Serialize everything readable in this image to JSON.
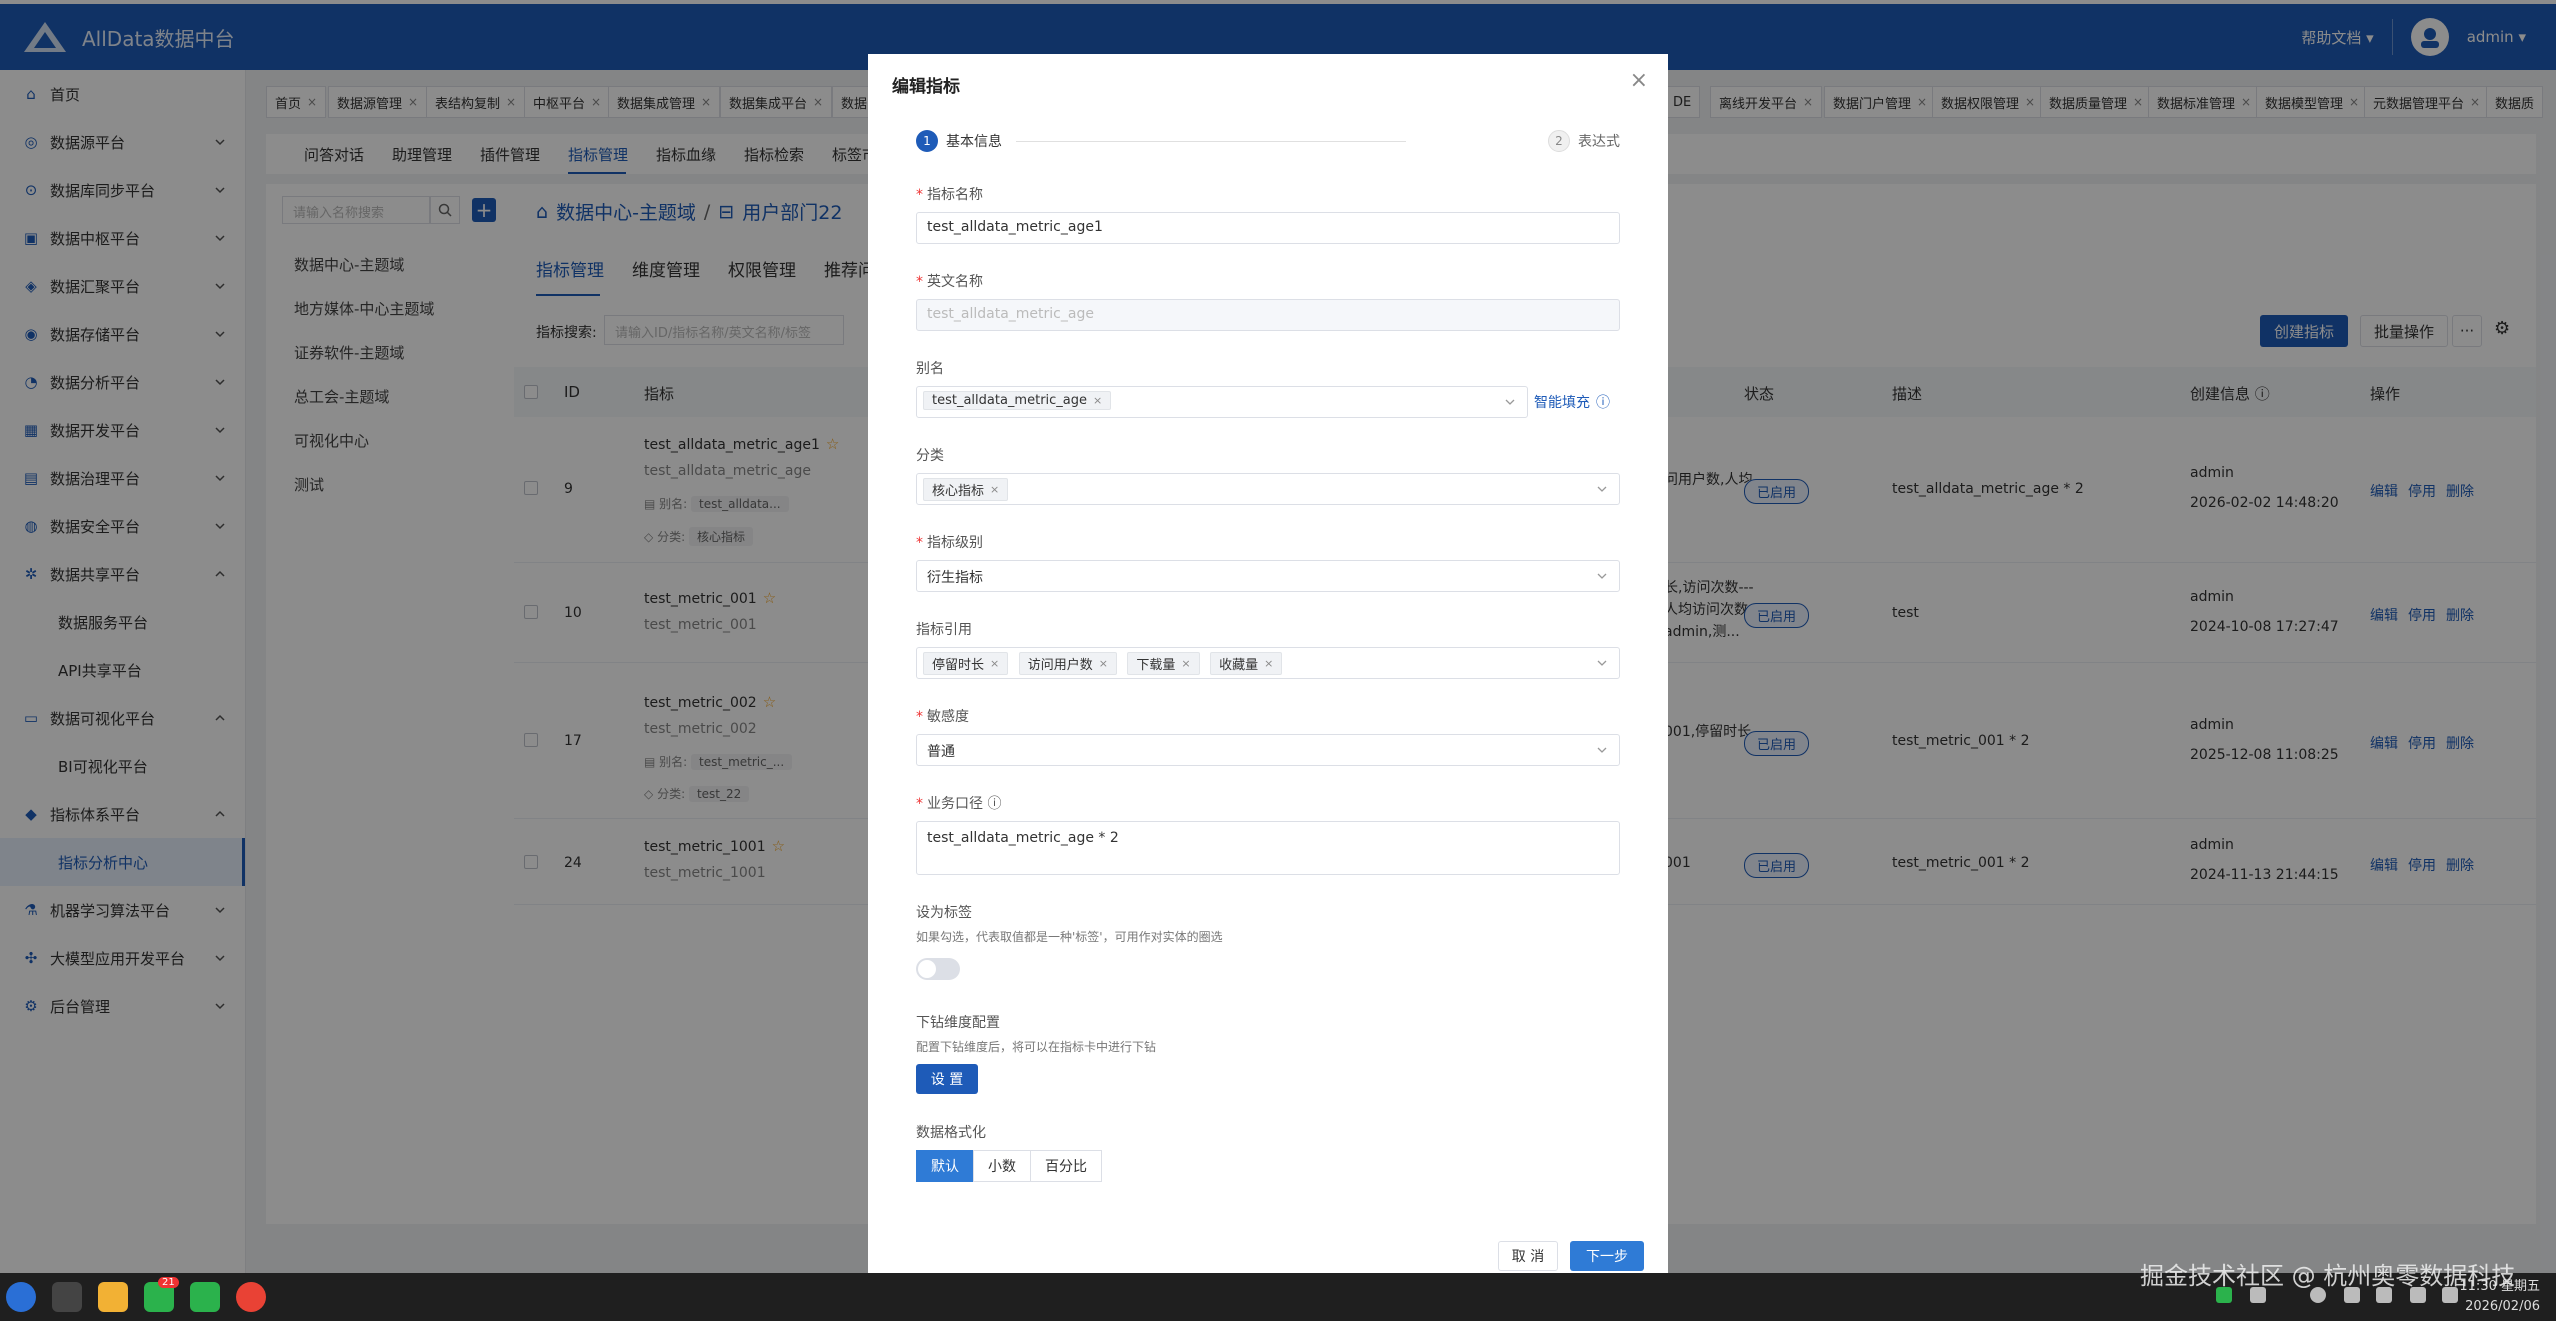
{
  "app": {
    "title": "AllData数据中台",
    "help": "帮助文档",
    "user": "admin"
  },
  "sidebar": {
    "items": [
      {
        "label": "首页"
      },
      {
        "label": "数据源平台"
      },
      {
        "label": "数据库同步平台"
      },
      {
        "label": "数据中枢平台"
      },
      {
        "label": "数据汇聚平台"
      },
      {
        "label": "数据存储平台"
      },
      {
        "label": "数据分析平台"
      },
      {
        "label": "数据开发平台"
      },
      {
        "label": "数据治理平台"
      },
      {
        "label": "数据安全平台"
      },
      {
        "label": "数据共享平台"
      },
      {
        "label": "数据服务平台"
      },
      {
        "label": "API共享平台"
      },
      {
        "label": "数据可视化平台"
      },
      {
        "label": "BI可视化平台"
      },
      {
        "label": "指标体系平台"
      },
      {
        "label": "指标分析中心"
      },
      {
        "label": "机器学习算法平台"
      },
      {
        "label": "大模型应用开发平台"
      },
      {
        "label": "后台管理"
      }
    ]
  },
  "tabs": {
    "left": [
      "首页",
      "数据源管理",
      "表结构复制",
      "中枢平台",
      "数据集成管理",
      "数据集成平台",
      "数据"
    ],
    "right": [
      "DE",
      "离线开发平台",
      "数据门户管理",
      "数据权限管理",
      "数据质量管理",
      "数据标准管理",
      "数据模型管理",
      "元数据管理平台",
      "数据质"
    ]
  },
  "subnav": [
    "问答对话",
    "助理管理",
    "插件管理",
    "指标管理",
    "指标血缘",
    "指标检索",
    "标签市"
  ],
  "tree": {
    "search_placeholder": "请输入名称搜索",
    "nodes": [
      "数据中心-主题域",
      "地方媒体-中心主题域",
      "证券软件-主题域",
      "总工会-主题域",
      "可视化中心",
      "测试"
    ]
  },
  "main": {
    "crumb1": "数据中心-主题域",
    "crumb2": "用户部门22",
    "tabs": [
      "指标管理",
      "维度管理",
      "权限管理",
      "推荐问"
    ],
    "search_label": "指标搜索:",
    "search_placeholder": "请输入ID/指标名称/英文名称/标签",
    "create_btn": "创建指标",
    "batch_btn": "批量操作",
    "more_btn": "···",
    "columns": {
      "id": "ID",
      "metric": "指标",
      "status": "状态",
      "desc": "描述",
      "created": "创建信息"
    },
    "rows": [
      {
        "id": "9",
        "name": "test_alldata_metric_age1",
        "en": "test_alldata_metric_age",
        "alias_label": "别名:",
        "alias": "test_alldata...",
        "cat_label": "分类:",
        "cat": "核心指标",
        "ref": "问用户数,人均",
        "status": "已启用",
        "desc": "test_alldata_metric_age * 2",
        "user": "admin",
        "time": "2026-02-02 14:48:20"
      },
      {
        "id": "10",
        "name": "test_metric_001",
        "en": "test_metric_001",
        "ref1": "长,访问次数---",
        "ref2": "人均访问次数",
        "ref3": "admin,测...",
        "status": "已启用",
        "desc": "test",
        "user": "admin",
        "time": "2024-10-08 17:27:47"
      },
      {
        "id": "17",
        "name": "test_metric_002",
        "en": "test_metric_002",
        "alias_label": "别名:",
        "alias": "test_metric_...",
        "cat_label": "分类:",
        "cat": "test_22",
        "ref": "001,停留时长",
        "status": "已启用",
        "desc": "test_metric_001 * 2",
        "user": "admin",
        "time": "2025-12-08 11:08:25"
      },
      {
        "id": "24",
        "name": "test_metric_1001",
        "en": "test_metric_1001",
        "ref": "001",
        "status": "已启用",
        "desc": "test_metric_001 * 2",
        "user": "admin",
        "time": "2024-11-13 21:44:15"
      }
    ],
    "ops": {
      "edit": "编辑",
      "disable": "停用",
      "delete": "删除"
    }
  },
  "modal": {
    "title": "编辑指标",
    "steps": [
      {
        "num": "1",
        "label": "基本信息"
      },
      {
        "num": "2",
        "label": "表达式"
      }
    ],
    "name_label": "指标名称",
    "name_value": "test_alldata_metric_age1",
    "en_label": "英文名称",
    "en_value": "test_alldata_metric_age",
    "alias_label": "别名",
    "alias_tags": [
      "test_alldata_metric_age"
    ],
    "smart_fill": "智能填充",
    "category_label": "分类",
    "category_tags": [
      "核心指标"
    ],
    "level_label": "指标级别",
    "level_value": "衍生指标",
    "ref_label": "指标引用",
    "ref_tags": [
      "停留时长",
      "访问用户数",
      "下载量",
      "收藏量"
    ],
    "sensitivity_label": "敏感度",
    "sensitivity_value": "普通",
    "caliber_label": "业务口径",
    "caliber_value": "test_alldata_metric_age * 2",
    "tag_label": "设为标签",
    "tag_hint": "如果勾选，代表取值都是一种'标签'，可用作对实体的圈选",
    "drill_label": "下钻维度配置",
    "drill_hint": "配置下钻维度后，将可以在指标卡中进行下钻",
    "drill_btn": "设 置",
    "format_label": "数据格式化",
    "format_options": [
      "默认",
      "小数",
      "百分比"
    ],
    "cancel": "取 消",
    "next": "下一步"
  },
  "taskbar": {
    "watermark": "掘金技术社区 @ 杭州奥零数据科技",
    "time": "11:30 星期五",
    "date": "2026/02/06",
    "badge": "21"
  },
  "colors": {
    "brand": "#1e5bb8",
    "accent": "#2f7bd6"
  }
}
